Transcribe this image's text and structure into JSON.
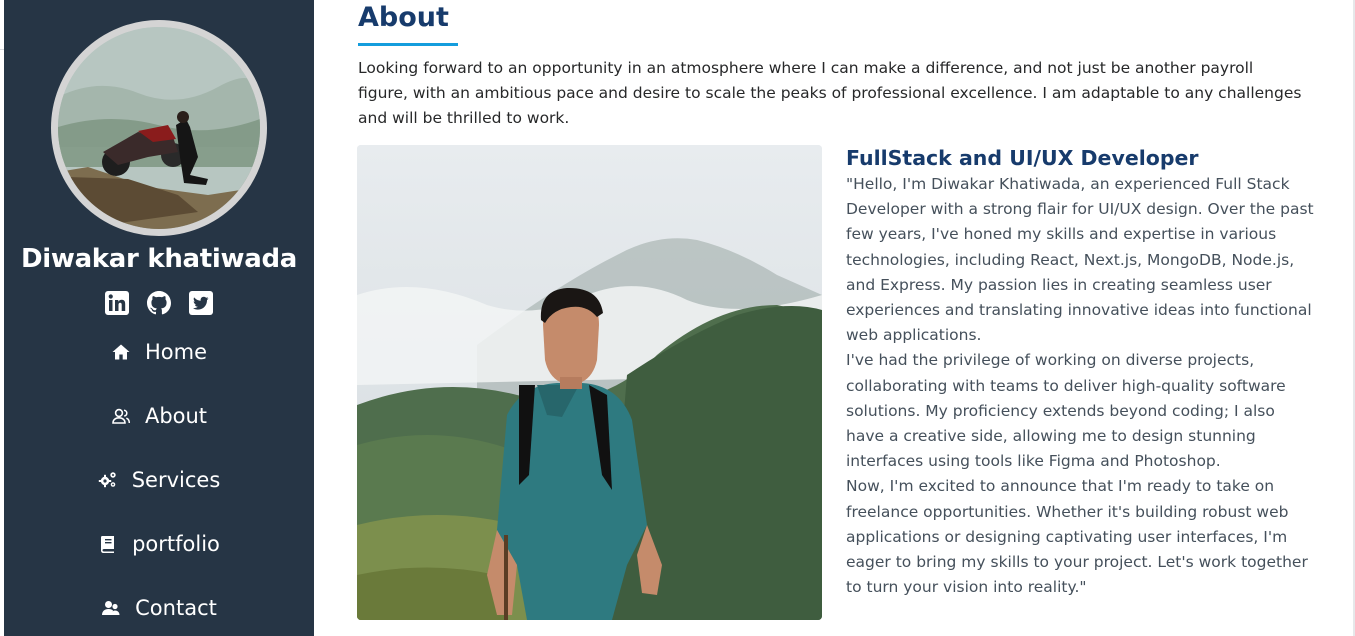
{
  "sidebar": {
    "name": "Diwakar khatiwada",
    "socials": [
      {
        "icon": "linkedin-icon"
      },
      {
        "icon": "github-icon"
      },
      {
        "icon": "twitter-icon"
      }
    ],
    "nav": [
      {
        "label": "Home",
        "icon": "home-icon"
      },
      {
        "label": "About",
        "icon": "user-icon"
      },
      {
        "label": "Services",
        "icon": "gears-icon"
      },
      {
        "label": "portfolio",
        "icon": "book-icon"
      },
      {
        "label": "Contact",
        "icon": "contact-icon"
      }
    ]
  },
  "about": {
    "title": "About",
    "intro": "Looking forward to an opportunity in an atmosphere where I can make a difference, and not just be another payroll figure, with an ambitious pace and desire to scale the peaks of professional excellence. I am adaptable to any challenges and will be thrilled to work.",
    "role": "FullStack and UI/UX Developer",
    "paragraphs": [
      "\"Hello, I'm Diwakar Khatiwada, an experienced Full Stack Developer with a strong flair for UI/UX design. Over the past few years, I've honed my skills and expertise in various technologies, including React, Next.js, MongoDB, Node.js, and Express. My passion lies in creating seamless user experiences and translating innovative ideas into functional web applications.",
      "I've had the privilege of working on diverse projects, collaborating with teams to deliver high-quality software solutions. My proficiency extends beyond coding; I also have a creative side, allowing me to design stunning interfaces using tools like Figma and Photoshop.",
      "Now, I'm excited to announce that I'm ready to take on freelance opportunities. Whether it's building robust web applications or designing captivating user interfaces, I'm eager to bring my skills to your project. Let's work together to turn your vision into reality.\""
    ]
  },
  "colors": {
    "sidebar_bg": "#263545",
    "title": "#173b6c",
    "accent": "#149ddd",
    "body_text": "#45505b"
  }
}
